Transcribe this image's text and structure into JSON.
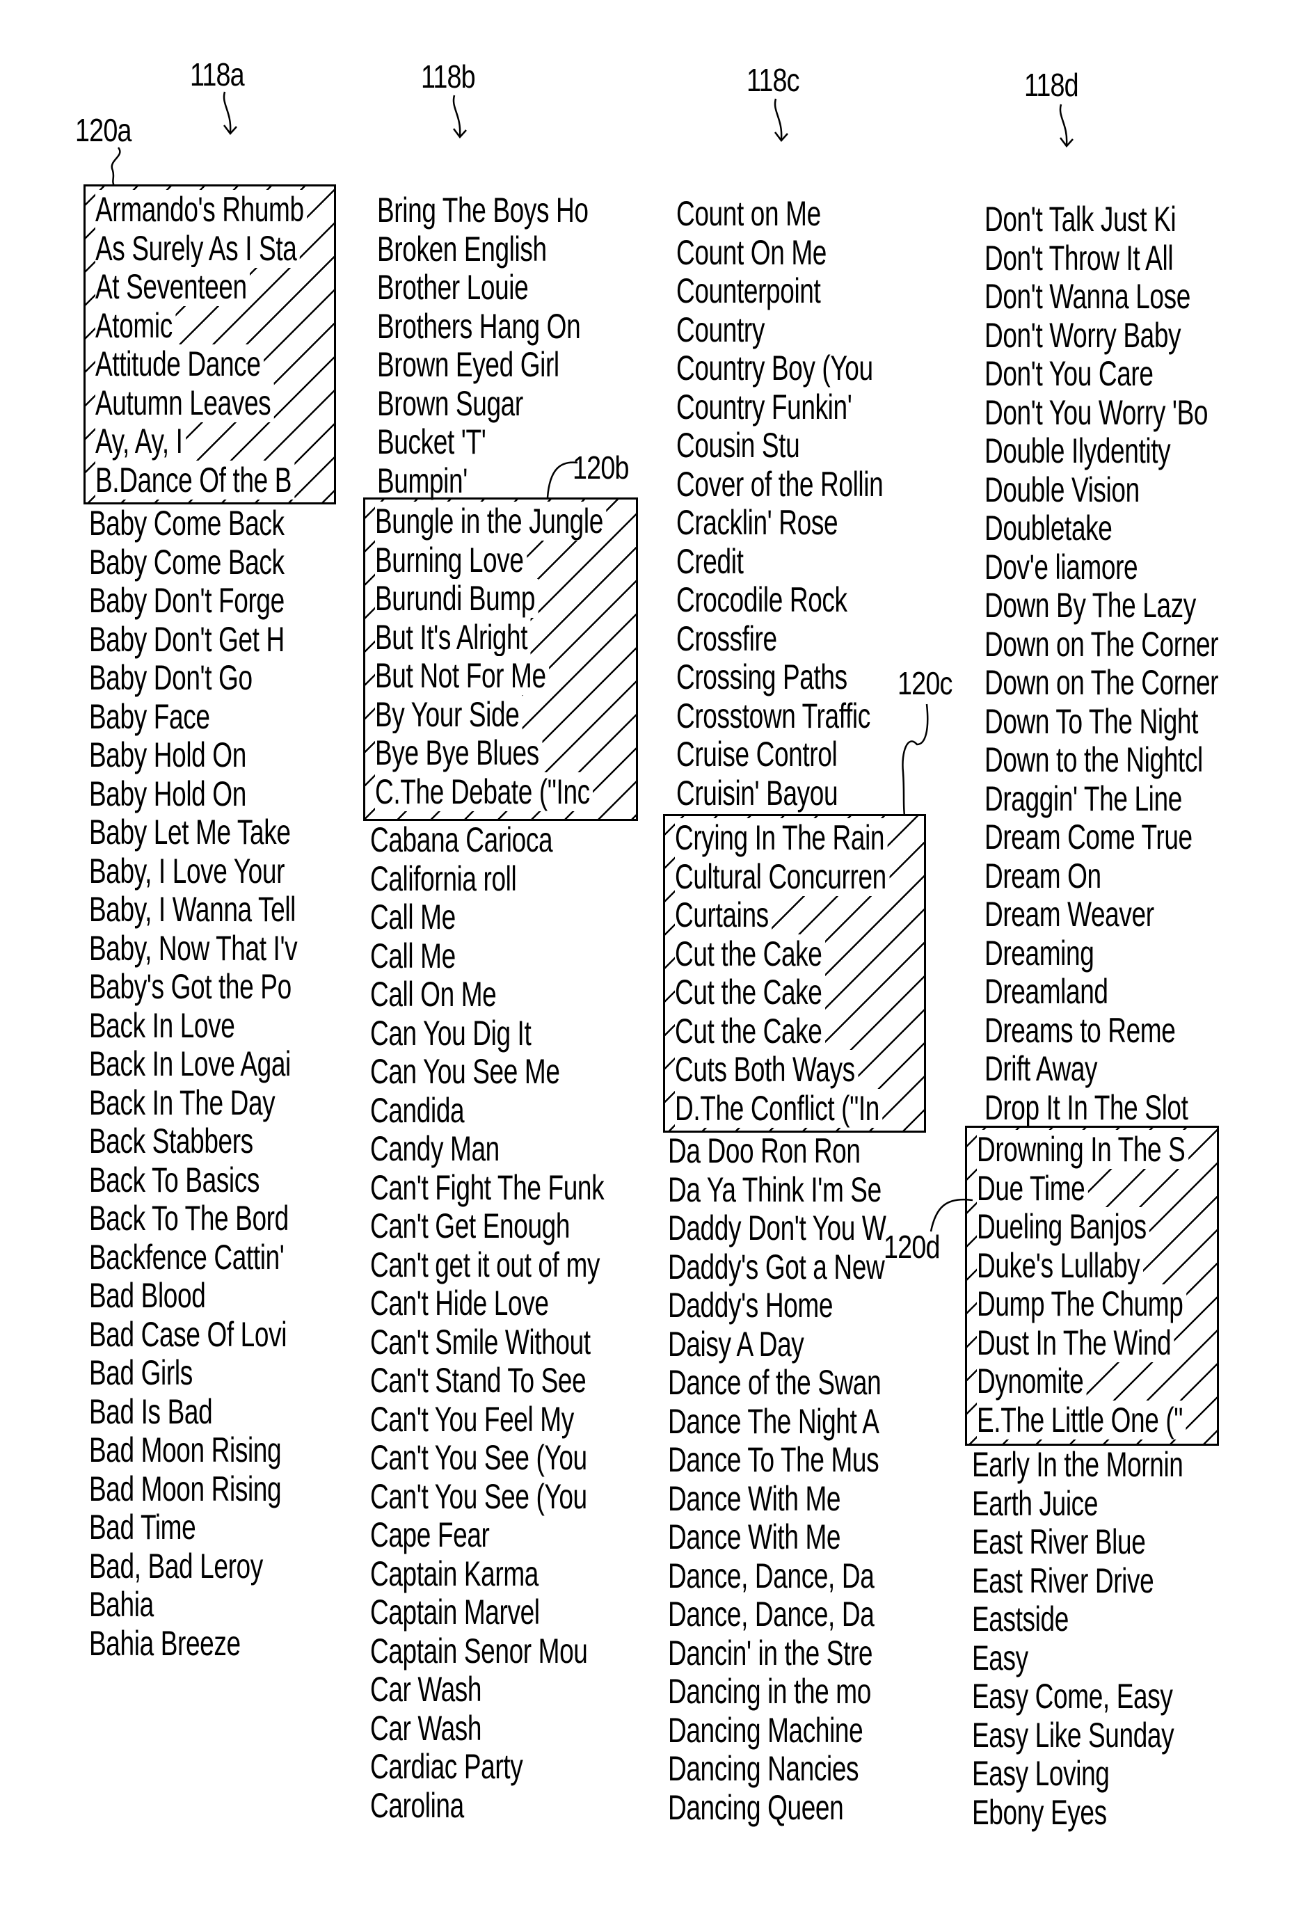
{
  "figure": {
    "columns": [
      {
        "ref": "118a",
        "box_ref": "120a",
        "highlighted": [
          "Armando's Rhumb",
          "As Surely As I Sta",
          "At Seventeen",
          "Atomic",
          "Attitude Dance",
          "Autumn Leaves",
          "Ay, Ay, I",
          "B.Dance Of the B"
        ],
        "items": [
          "Baby Come Back",
          "Baby Come Back",
          "Baby Don't Forge",
          "Baby Don't Get H",
          "Baby Don't Go",
          "Baby Face",
          "Baby Hold On",
          "Baby Hold On",
          "Baby Let Me Take",
          "Baby, I Love Your",
          "Baby, I Wanna Tell",
          "Baby, Now That I'v",
          "Baby's Got the Po",
          "Back In Love",
          "Back In Love Agai",
          "Back In The Day",
          "Back Stabbers",
          "Back To Basics",
          "Back To The Bord",
          "Backfence Cattin'",
          "Bad Blood",
          "Bad Case Of Lovi",
          "Bad Girls",
          "Bad Is Bad",
          "Bad Moon Rising",
          "Bad Moon Rising",
          "Bad Time",
          "Bad, Bad Leroy",
          "Bahia",
          "Bahia Breeze"
        ]
      },
      {
        "ref": "118b",
        "box_ref": "120b",
        "before": [
          "Bring The Boys Ho",
          "Broken English",
          "Brother Louie",
          "Brothers Hang On",
          "Brown Eyed Girl",
          "Brown Sugar",
          "Bucket 'T'",
          "Bumpin'"
        ],
        "highlighted": [
          "Bungle in the Jungle",
          "Burning Love",
          "Burundi Bump",
          "But It's Alright",
          "But Not For Me",
          "By Your Side",
          "Bye Bye Blues",
          "C.The Debate (\"Inc"
        ],
        "items": [
          "Cabana Carioca",
          "California roll",
          "Call Me",
          "Call Me",
          "Call On Me",
          "Can You Dig It",
          "Can You See Me",
          "Candida",
          "Candy Man",
          "Can't Fight The Funk",
          "Can't Get Enough",
          "Can't get it out of my",
          "Can't Hide Love",
          "Can't Smile Without",
          "Can't Stand To See",
          "Can't You Feel My",
          "Can't You See (You",
          "Can't You See (You",
          "Cape Fear",
          "Captain Karma",
          "Captain Marvel",
          "Captain Senor Mou",
          "Car Wash",
          "Car Wash",
          "Cardiac Party",
          "Carolina"
        ]
      },
      {
        "ref": "118c",
        "box_ref": "120c",
        "before": [
          "Count on Me",
          "Count On Me",
          "Counterpoint",
          "Country",
          "Country Boy (You",
          "Country Funkin'",
          "Cousin Stu",
          "Cover of the Rollin",
          "Cracklin' Rose",
          "Credit",
          "Crocodile Rock",
          "Crossfire",
          "Crossing Paths",
          "Crosstown Traffic",
          "Cruise Control",
          "Cruisin' Bayou"
        ],
        "highlighted": [
          "Crying In The Rain",
          "Cultural Concurren",
          "Curtains",
          "Cut the Cake",
          "Cut the Cake",
          "Cut the Cake",
          "Cuts Both Ways",
          "D.The Conflict (\"In"
        ],
        "items": [
          "Da Doo Ron Ron",
          "Da Ya Think I'm Se",
          "Daddy Don't You W",
          "Daddy's Got a New",
          "Daddy's Home",
          "Daisy A Day",
          "Dance of the Swan",
          "Dance The Night A",
          "Dance To The Mus",
          "Dance With Me",
          "Dance With Me",
          "Dance, Dance, Da",
          "Dance, Dance, Da",
          "Dancin' in the Stre",
          "Dancing in the mo",
          "Dancing Machine",
          "Dancing Nancies",
          "Dancing Queen"
        ]
      },
      {
        "ref": "118d",
        "box_ref": "120d",
        "before": [
          "Don't Talk Just Ki",
          "Don't Throw It All",
          "Don't Wanna Lose",
          "Don't Worry Baby",
          "Don't You Care",
          "Don't You Worry 'Bo",
          "Double Ilydentity",
          "Double Vision",
          "Doubletake",
          "Dov'e liamore",
          "Down By The Lazy",
          "Down on The Corner",
          "Down on The Corner",
          "Down To The Night",
          "Down to the Nightcl",
          "Draggin' The Line",
          "Dream Come True",
          "Dream On",
          "Dream Weaver",
          "Dreaming",
          "Dreamland",
          "Dreams to Reme",
          "Drift Away",
          "Drop It In The Slot"
        ],
        "highlighted": [
          "Drowning In The S",
          "Due Time",
          "Dueling Banjos",
          "Duke's Lullaby",
          "Dump The Chump",
          "Dust In The Wind",
          "Dynomite",
          "E.The Little One (\""
        ],
        "items": [
          "Early In the Mornin",
          "Earth Juice",
          "East River Blue",
          "East River Drive",
          "Eastside",
          "Easy",
          "Easy Come, Easy",
          "Easy Like Sunday",
          "Easy Loving",
          "Ebony Eyes"
        ]
      }
    ]
  }
}
